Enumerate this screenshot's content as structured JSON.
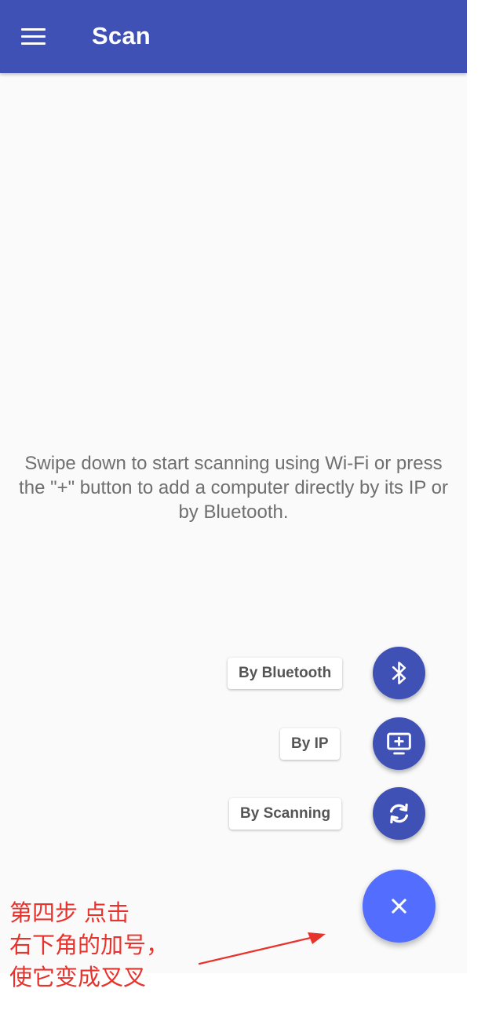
{
  "appbar": {
    "title": "Scan",
    "menu_icon": "hamburger-menu-icon",
    "color": "#3f51b5"
  },
  "main": {
    "empty_text": "Swipe down to start scanning using Wi-Fi or press the \"+\" button to add a computer directly by its IP or by Bluetooth."
  },
  "fab_menu": {
    "items": [
      {
        "label": "By Bluetooth",
        "icon": "bluetooth-icon"
      },
      {
        "label": "By IP",
        "icon": "add-to-screen-icon"
      },
      {
        "label": "By Scanning",
        "icon": "refresh-icon"
      }
    ],
    "main_icon": "close-icon",
    "main_color": "#536dfe",
    "mini_color": "#3f51b5"
  },
  "annotation": {
    "lines": [
      "第四步 点击",
      "右下角的加号，",
      "使它变成叉叉"
    ],
    "color": "#e8332d"
  }
}
